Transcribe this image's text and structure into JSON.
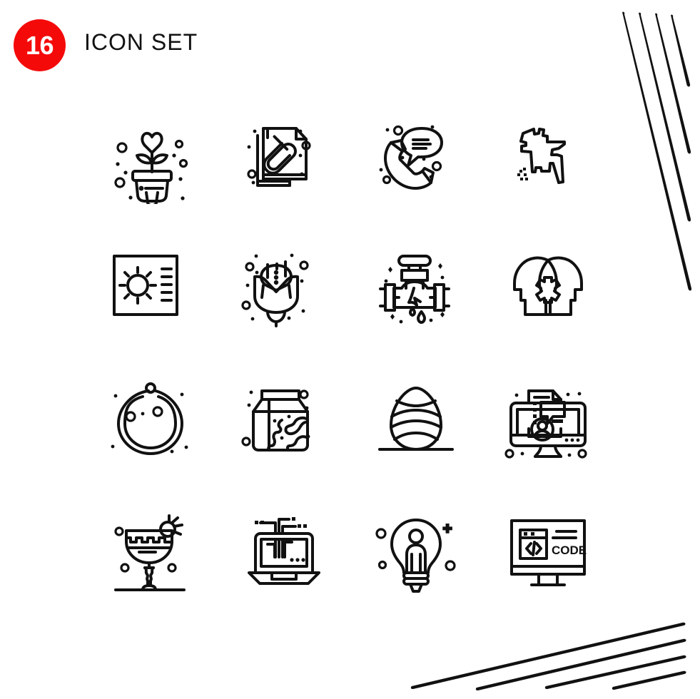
{
  "header": {
    "count": "16",
    "title": "ICON SET",
    "badge_color": "#f50a0a",
    "badge_text_color": "#ffffff",
    "title_color": "#121212"
  },
  "grid": {
    "columns": 4,
    "rows": 4,
    "total_icons": 16,
    "stroke_color": "#111111",
    "style": "outline"
  },
  "icons": [
    {
      "position": 1,
      "row": 1,
      "col": 1,
      "name": "plant-heart-icon",
      "label": "Potted plant with heart"
    },
    {
      "position": 2,
      "row": 1,
      "col": 2,
      "name": "attachment-files-icon",
      "label": "Documents with paperclip"
    },
    {
      "position": 3,
      "row": 1,
      "col": 3,
      "name": "call-support-icon",
      "label": "Phone receiver with chat bubble"
    },
    {
      "position": 4,
      "row": 1,
      "col": 4,
      "name": "bangladesh-map-icon",
      "label": "Country map outline"
    },
    {
      "position": 5,
      "row": 2,
      "col": 1,
      "name": "brightness-icon",
      "label": "Sun brightness control"
    },
    {
      "position": 6,
      "row": 2,
      "col": 2,
      "name": "rose-flower-icon",
      "label": "Rose bud flower"
    },
    {
      "position": 7,
      "row": 2,
      "col": 3,
      "name": "leaking-pipe-icon",
      "label": "Valve pipe with water drops"
    },
    {
      "position": 8,
      "row": 2,
      "col": 4,
      "name": "teamwork-heads-gear-icon",
      "label": "Two heads with gear"
    },
    {
      "position": 9,
      "row": 3,
      "col": 1,
      "name": "pearl-necklace-icon",
      "label": "Pearl necklace"
    },
    {
      "position": 10,
      "row": 3,
      "col": 2,
      "name": "milk-carton-icon",
      "label": "Milk carton with spots"
    },
    {
      "position": 11,
      "row": 3,
      "col": 3,
      "name": "easter-egg-icon",
      "label": "Striped easter egg"
    },
    {
      "position": 12,
      "row": 3,
      "col": 4,
      "name": "online-support-monitor-icon",
      "label": "Monitor with chat and user"
    },
    {
      "position": 13,
      "row": 4,
      "col": 1,
      "name": "cocktail-glass-icon",
      "label": "Cocktail glass with garnish"
    },
    {
      "position": 14,
      "row": 4,
      "col": 2,
      "name": "laptop-circuit-icon",
      "label": "Laptop with circuit lines"
    },
    {
      "position": 15,
      "row": 4,
      "col": 3,
      "name": "idea-bulb-person-icon",
      "label": "Light bulb with person"
    },
    {
      "position": 16,
      "row": 4,
      "col": 4,
      "name": "code-monitor-icon",
      "label": "Monitor with code window"
    }
  ],
  "icon_text": {
    "code_label": "CODE"
  },
  "decorations": {
    "top_right": {
      "name": "diagonal-strokes-top-right",
      "count": 4,
      "color": "#111111"
    },
    "bottom_right": {
      "name": "diagonal-strokes-bottom-right",
      "count": 4,
      "color": "#111111"
    }
  }
}
